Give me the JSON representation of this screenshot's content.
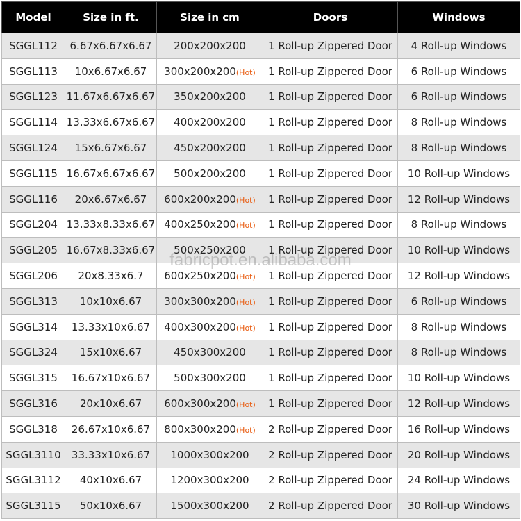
{
  "table": {
    "headers": [
      "Model",
      "Size in ft.",
      "Size in cm",
      "Doors",
      "Windows"
    ],
    "hot_label": "(Hot)",
    "rows": [
      {
        "model": "SGGL112",
        "ft": "6.67x6.67x6.67",
        "cm": "200x200x200",
        "hot": false,
        "doors": "1 Roll-up Zippered Door",
        "windows": "4 Roll-up Windows"
      },
      {
        "model": "SGGL113",
        "ft": "10x6.67x6.67",
        "cm": "300x200x200",
        "hot": true,
        "doors": "1 Roll-up Zippered Door",
        "windows": "6 Roll-up Windows"
      },
      {
        "model": "SGGL123",
        "ft": "11.67x6.67x6.67",
        "cm": "350x200x200",
        "hot": false,
        "doors": "1 Roll-up Zippered Door",
        "windows": "6 Roll-up Windows"
      },
      {
        "model": "SGGL114",
        "ft": "13.33x6.67x6.67",
        "cm": "400x200x200",
        "hot": false,
        "doors": "1 Roll-up Zippered Door",
        "windows": "8 Roll-up Windows"
      },
      {
        "model": "SGGL124",
        "ft": "15x6.67x6.67",
        "cm": "450x200x200",
        "hot": false,
        "doors": "1 Roll-up Zippered Door",
        "windows": "8 Roll-up Windows"
      },
      {
        "model": "SGGL115",
        "ft": "16.67x6.67x6.67",
        "cm": "500x200x200",
        "hot": false,
        "doors": "1 Roll-up Zippered Door",
        "windows": "10 Roll-up Windows"
      },
      {
        "model": "SGGL116",
        "ft": "20x6.67x6.67",
        "cm": "600x200x200",
        "hot": true,
        "doors": "1 Roll-up Zippered Door",
        "windows": "12 Roll-up Windows"
      },
      {
        "model": "SGGL204",
        "ft": "13.33x8.33x6.67",
        "cm": "400x250x200",
        "hot": true,
        "doors": "1 Roll-up Zippered Door",
        "windows": "8 Roll-up Windows"
      },
      {
        "model": "SGGL205",
        "ft": "16.67x8.33x6.67",
        "cm": "500x250x200",
        "hot": false,
        "doors": "1 Roll-up Zippered Door",
        "windows": "10 Roll-up Windows"
      },
      {
        "model": "SGGL206",
        "ft": "20x8.33x6.7",
        "cm": "600x250x200",
        "hot": true,
        "doors": "1 Roll-up Zippered Door",
        "windows": "12 Roll-up Windows"
      },
      {
        "model": "SGGL313",
        "ft": "10x10x6.67",
        "cm": "300x300x200",
        "hot": true,
        "doors": "1 Roll-up Zippered Door",
        "windows": "6 Roll-up Windows"
      },
      {
        "model": "SGGL314",
        "ft": "13.33x10x6.67",
        "cm": "400x300x200",
        "hot": true,
        "doors": "1 Roll-up Zippered Door",
        "windows": "8 Roll-up Windows"
      },
      {
        "model": "SGGL324",
        "ft": "15x10x6.67",
        "cm": "450x300x200",
        "hot": false,
        "doors": "1 Roll-up Zippered Door",
        "windows": "8 Roll-up Windows"
      },
      {
        "model": "SGGL315",
        "ft": "16.67x10x6.67",
        "cm": "500x300x200",
        "hot": false,
        "doors": "1 Roll-up Zippered Door",
        "windows": "10 Roll-up Windows"
      },
      {
        "model": "SGGL316",
        "ft": "20x10x6.67",
        "cm": "600x300x200",
        "hot": true,
        "doors": "1 Roll-up Zippered Door",
        "windows": "12 Roll-up Windows"
      },
      {
        "model": "SGGL318",
        "ft": "26.67x10x6.67",
        "cm": "800x300x200",
        "hot": true,
        "doors": "2 Roll-up Zippered Door",
        "windows": "16 Roll-up Windows"
      },
      {
        "model": "SGGL3110",
        "ft": "33.33x10x6.67",
        "cm": "1000x300x200",
        "hot": false,
        "doors": "2 Roll-up Zippered Door",
        "windows": "20 Roll-up Windows"
      },
      {
        "model": "SGGL3112",
        "ft": "40x10x6.67",
        "cm": "1200x300x200",
        "hot": false,
        "doors": "2 Roll-up Zippered Door",
        "windows": "24 Roll-up Windows"
      },
      {
        "model": "SGGL3115",
        "ft": "50x10x6.67",
        "cm": "1500x300x200",
        "hot": false,
        "doors": "2 Roll-up Zippered Door",
        "windows": "30 Roll-up Windows"
      }
    ]
  },
  "watermark": "fabricpot.en.alibaba.com",
  "colors": {
    "header_bg": "#000000",
    "header_text": "#ffffff",
    "row_stripe": "#e6e6e6",
    "hot_text": "#e8590c"
  }
}
